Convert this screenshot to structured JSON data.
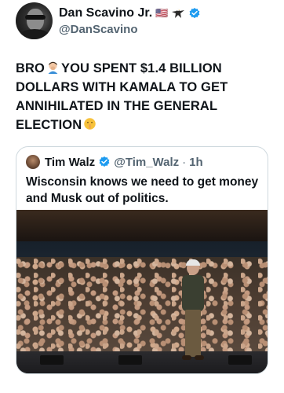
{
  "post": {
    "author": {
      "display_name": "Dan Scavino Jr.",
      "flag": "🇺🇸",
      "eagle_icon": "eagle-icon",
      "verified_icon": "verified-badge-icon",
      "handle": "@DanScavino"
    },
    "text_parts": [
      "BRO",
      "YOU SPENT $1.4 BILLION DOLLARS WITH KAMALA TO GET ANNIHILATED IN THE GENERAL ELECTION"
    ],
    "emojis": [
      "man-facepalming-emoji",
      "shushing-face-emoji"
    ]
  },
  "quote": {
    "author": {
      "display_name": "Tim Walz",
      "verified_icon": "verified-badge-icon",
      "handle": "@Tim_Walz",
      "separator": "·",
      "time": "1h"
    },
    "text": "Wisconsin knows we need to get money and Musk out of politics.",
    "image": "photo-speaker-on-stage-crowd"
  },
  "colors": {
    "text_primary": "#0f1419",
    "text_secondary": "#536471",
    "verified_blue": "#1d9bf0",
    "border": "#cfd9de"
  }
}
